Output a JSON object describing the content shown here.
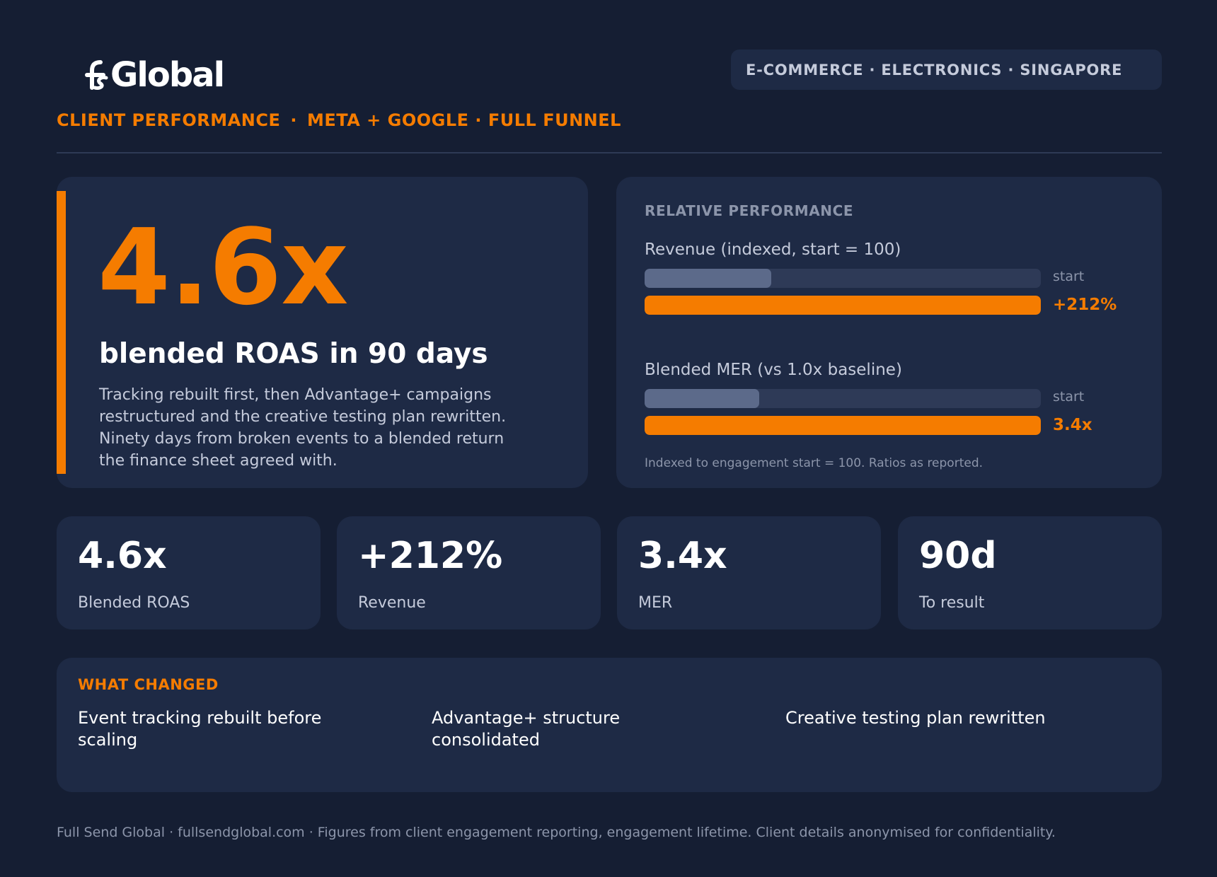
{
  "header": {
    "logo_text": "Global",
    "kicker_left": "CLIENT PERFORMANCE",
    "kicker_sep": "·",
    "kicker_right": "META + GOOGLE · FULL FUNNEL",
    "tag": "E-COMMERCE · ELECTRONICS · SINGAPORE"
  },
  "hero": {
    "big_value": "4.6x",
    "title": "blended ROAS in 90 days",
    "description": "Tracking rebuilt first, then Advantage+ campaigns restructured and the creative testing plan rewritten. Ninety days from broken events to a blended return the finance sheet agreed with."
  },
  "performance": {
    "heading": "RELATIVE PERFORMANCE",
    "bars": [
      {
        "label": "Revenue (indexed, start = 100)",
        "start_label": "start",
        "start_fraction": 0.32,
        "after_label": "+212%",
        "after_fraction": 1.0
      },
      {
        "label": "Blended MER (vs 1.0x baseline)",
        "start_label": "start",
        "start_fraction": 0.29,
        "after_label": "3.4x",
        "after_fraction": 1.0
      }
    ],
    "note": "Indexed to engagement start = 100. Ratios as reported."
  },
  "stats": [
    {
      "value": "4.6x",
      "label": "Blended ROAS"
    },
    {
      "value": "+212%",
      "label": "Revenue"
    },
    {
      "value": "3.4x",
      "label": "MER"
    },
    {
      "value": "90d",
      "label": "To result"
    }
  ],
  "changes": {
    "heading": "WHAT CHANGED",
    "items": [
      "Event tracking rebuilt before scaling",
      "Advantage+ structure consolidated",
      "Creative testing plan rewritten"
    ]
  },
  "footer": "Full Send Global · fullsendglobal.com · Figures from client engagement reporting, engagement lifetime. Client details anonymised for confidentiality.",
  "colors": {
    "background": "#151e33",
    "card": "#1e2a45",
    "accent": "#f57c00",
    "track": "#2e3a57",
    "start_fill": "#5c6a8a"
  }
}
